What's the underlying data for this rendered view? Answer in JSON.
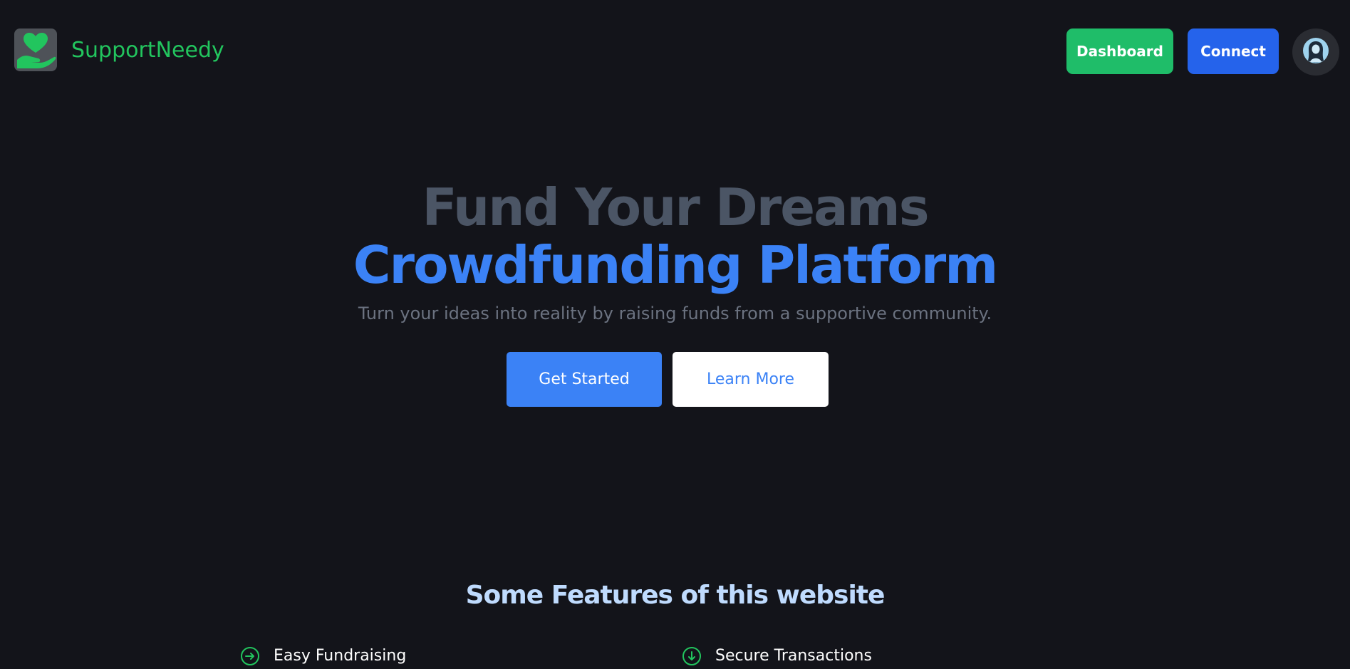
{
  "brand": {
    "name": "SupportNeedy",
    "logo_icon": "heart-hand-icon"
  },
  "nav": {
    "dashboard_label": "Dashboard",
    "connect_label": "Connect",
    "avatar_icon": "user-avatar-icon"
  },
  "hero": {
    "title_line1": "Fund Your Dreams",
    "title_line2": "Crowdfunding Platform",
    "subtitle": "Turn your ideas into reality by raising funds from a supportive community.",
    "get_started_label": "Get Started",
    "learn_more_label": "Learn More"
  },
  "features": {
    "title": "Some Features of this website",
    "items": [
      {
        "label": "Easy Fundraising",
        "icon": "arrow-right-circle-icon"
      },
      {
        "label": "Secure Transactions",
        "icon": "arrow-down-circle-icon"
      }
    ]
  },
  "colors": {
    "background": "#13141a",
    "brand_green": "#22c55e",
    "dashboard_button": "#1fbd69",
    "connect_button": "#2563eb",
    "accent_blue": "#3b82f6",
    "hero_gray": "#4b5565",
    "subtitle_gray": "#6b7280",
    "features_title": "#bfdbfe"
  }
}
